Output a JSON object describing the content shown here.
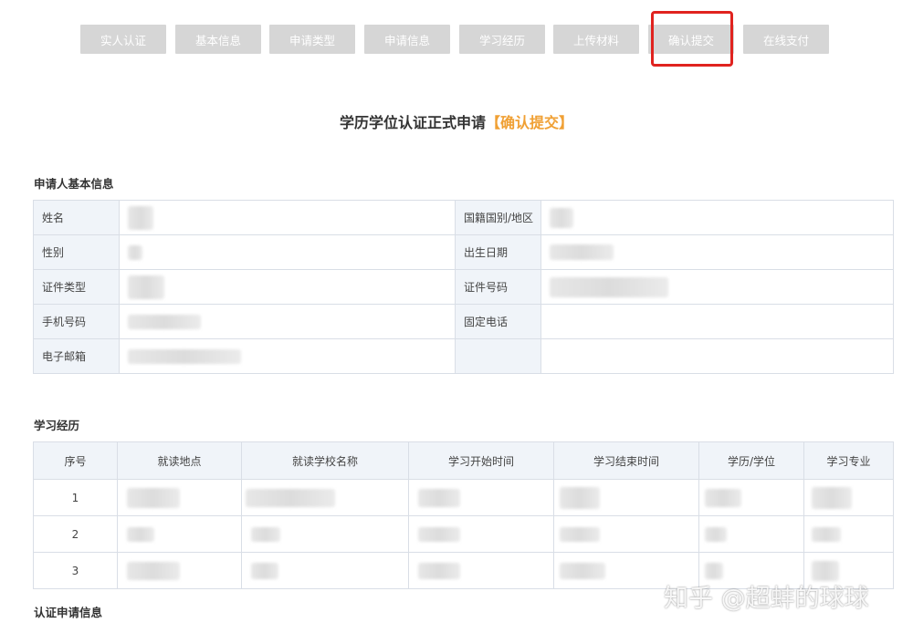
{
  "steps": [
    {
      "label": "实人认证"
    },
    {
      "label": "基本信息"
    },
    {
      "label": "申请类型"
    },
    {
      "label": "申请信息"
    },
    {
      "label": "学习经历"
    },
    {
      "label": "上传材料"
    },
    {
      "label": "确认提交"
    },
    {
      "label": "在线支付"
    }
  ],
  "page_title": {
    "main": "学历学位认证正式申请",
    "status": "【确认提交】"
  },
  "applicant": {
    "section_title": "申请人基本信息",
    "labels": {
      "name": "姓名",
      "nationality": "国籍国别/地区",
      "gender": "性别",
      "birth_date": "出生日期",
      "id_type": "证件类型",
      "id_number": "证件号码",
      "mobile": "手机号码",
      "landline": "固定电话",
      "email": "电子邮箱"
    }
  },
  "education": {
    "section_title": "学习经历",
    "columns": [
      "序号",
      "就读地点",
      "就读学校名称",
      "学习开始时间",
      "学习结束时间",
      "学历/学位",
      "学习专业"
    ],
    "rows": [
      {
        "index": "1"
      },
      {
        "index": "2"
      },
      {
        "index": "3"
      }
    ]
  },
  "certification": {
    "section_title": "认证申请信息"
  },
  "watermark": "知乎 @超蚌的球球",
  "colors": {
    "step_bg": "#d6d6d6",
    "highlight": "#e0231f",
    "status": "#f0a034",
    "label_bg": "#f0f4f9"
  }
}
